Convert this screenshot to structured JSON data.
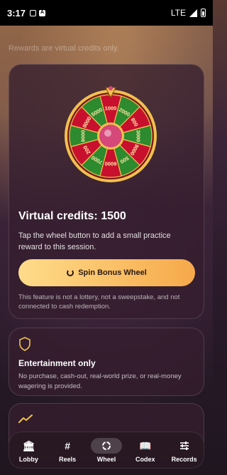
{
  "statusbar": {
    "time": "3:17",
    "network": "LTE"
  },
  "top_faded_text": "Rewards are virtual credits only.",
  "wheel": {
    "segments": [
      "1000",
      "2000",
      "800",
      "3000",
      "9000",
      "500",
      "6000",
      "7000",
      "200",
      "9000",
      "8000",
      "5000"
    ],
    "colors": {
      "red": "#c8102e",
      "green": "#2d8a2e",
      "gold": "#f2c14e",
      "hub": "#d6487a"
    }
  },
  "main": {
    "credits_label": "Virtual credits: 1500",
    "description": "Tap the wheel button to add a small practice reward to this session.",
    "spin_label": "Spin Bonus Wheel",
    "disclaimer": "This feature is not a lottery, not a sweepstake, and not connected to cash redemption."
  },
  "entertainment": {
    "title": "Entertainment only",
    "text": "No purchase, cash-out, real-world prize, or real-money wagering is provided."
  },
  "nav": {
    "items": [
      {
        "label": "Lobby",
        "icon": "bank-icon"
      },
      {
        "label": "Reels",
        "icon": "hash-icon"
      },
      {
        "label": "Wheel",
        "icon": "wheel-icon"
      },
      {
        "label": "Codex",
        "icon": "book-icon"
      },
      {
        "label": "Records",
        "icon": "sliders-icon"
      }
    ],
    "active": "Wheel"
  },
  "colors": {
    "accent": "#f6a94a",
    "card_bg": "#341e2e"
  }
}
